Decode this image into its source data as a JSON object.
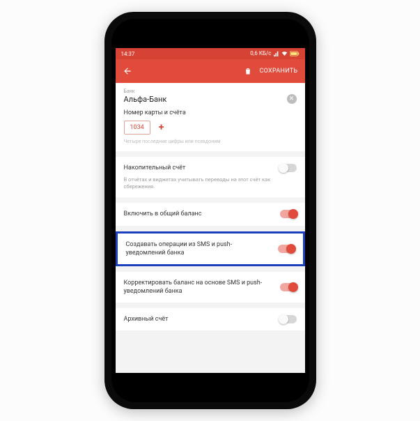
{
  "status_bar": {
    "time": "14:37",
    "net_speed": "0,6 КБ/с"
  },
  "app_bar": {
    "save_label": "СОХРАНИТЬ"
  },
  "bank": {
    "field_label": "Банк",
    "name": "Альфа-Банк"
  },
  "card": {
    "title": "Номер карты и счёта",
    "value": "1034",
    "hint": "Четыре последние цифры или псевдоним"
  },
  "rows": {
    "savings": {
      "label": "Накопительный счёт",
      "sub": "В отчётах и виджетах учитывать переводы на этот счёт как сбережения."
    },
    "include_balance": {
      "label": "Включить в общий баланс"
    },
    "sms_push": {
      "label": "Создавать операции из SMS и push-уведомлений банка"
    },
    "correct_balance": {
      "label": "Корректировать баланс на основе SMS и push-уведомлений банка"
    },
    "archive": {
      "label": "Архивный счёт"
    }
  }
}
